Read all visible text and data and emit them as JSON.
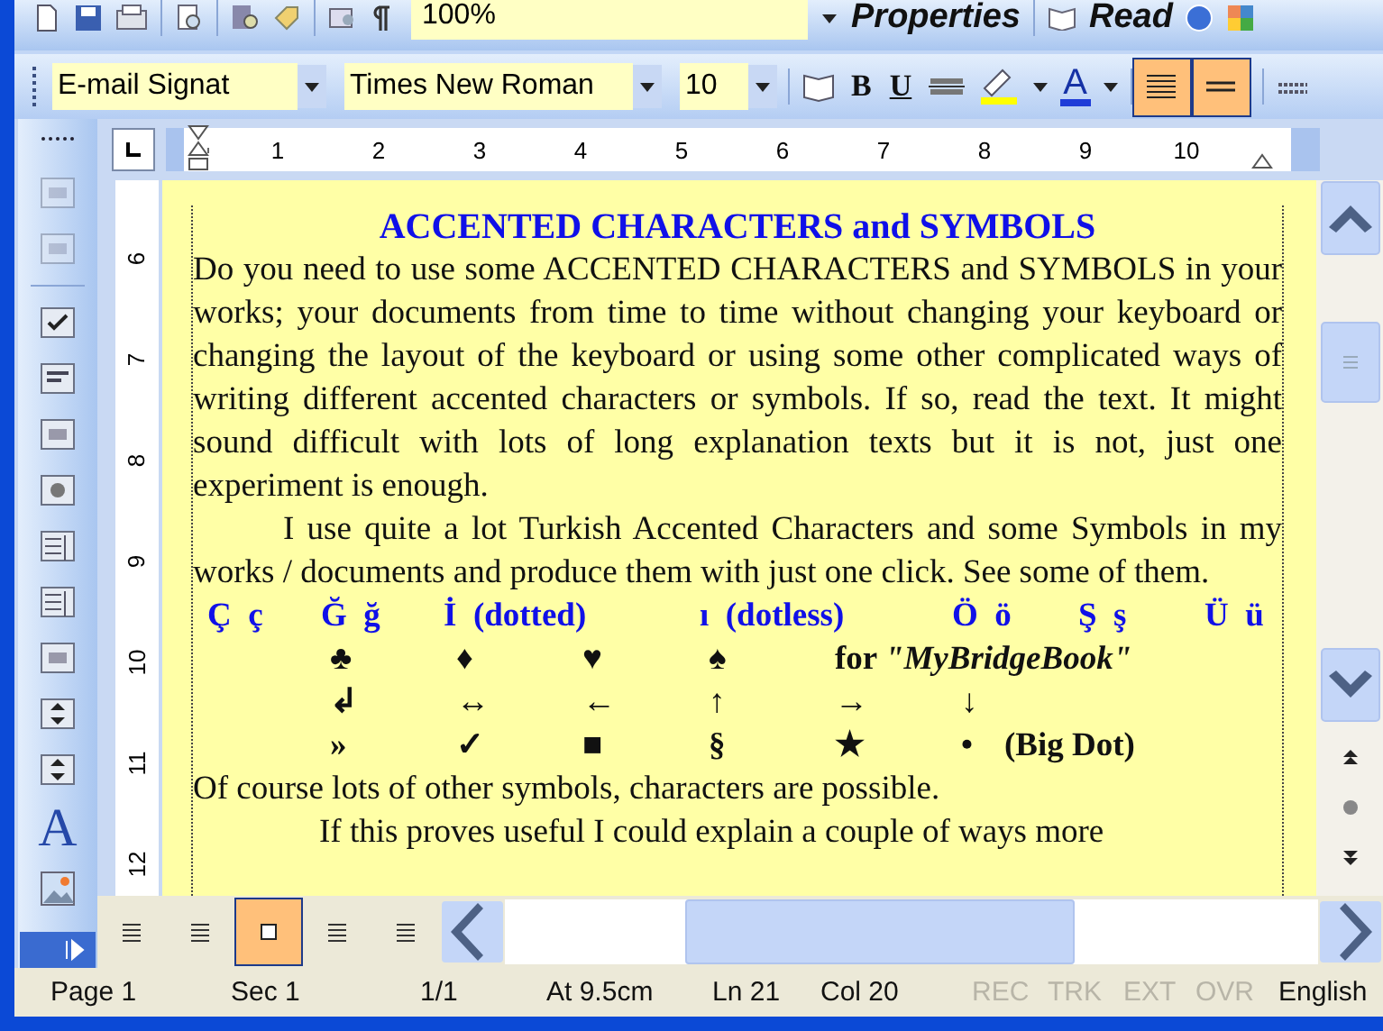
{
  "standard_toolbar": {
    "zoom": "100%",
    "properties": "Properties",
    "read": "Read"
  },
  "formatting_toolbar": {
    "style": "E-mail Signat",
    "font": "Times New Roman",
    "size": "10",
    "bold": "B",
    "underline": "U",
    "font_color": "A",
    "align_buttons": [
      {
        "selected": true
      },
      {
        "selected": true
      }
    ]
  },
  "left_toolbar": {
    "label_tool": "A"
  },
  "horizontal_ruler": [
    "1",
    "2",
    "3",
    "4",
    "5",
    "6",
    "7",
    "8",
    "9",
    "10"
  ],
  "vertical_ruler": [
    "6",
    "7",
    "8",
    "9",
    "10",
    "11",
    "12"
  ],
  "document": {
    "title": "ACCENTED CHARACTERS and SYMBOLS",
    "paragraphs": [
      {
        "text": "Do you need to use some ACCENTED CHARACTERS and SYMBOLS in your works; your documents from time to time without changing your keyboard or changing the layout of the keyboard or using some other complicated ways of writing different accented characters or symbols. If so, read the text. It might sound difficult with lots of long explanation texts but it is not, just one experiment is enough.",
        "indent": false
      },
      {
        "text": "I use quite a lot Turkish Accented Characters and some Symbols in my works / documents and produce them with just one click. See some of them.",
        "indent": true
      }
    ],
    "letters": [
      "Ç  ç",
      "Ğ  ğ",
      "İ  (dotted)",
      "ı  (dotless)",
      "Ö  ö",
      "Ş  ş",
      "Ü  ü"
    ],
    "symbol_rows": [
      [
        {
          "kind": "symbol",
          "text": "♣"
        },
        {
          "kind": "symbol",
          "text": "♦"
        },
        {
          "kind": "symbol",
          "text": "♥"
        },
        {
          "kind": "symbol",
          "text": "♠"
        },
        {
          "kind": "label",
          "text": "for *\"MyBridgeBook\"*"
        }
      ],
      [
        {
          "kind": "symbol",
          "text": "↲"
        },
        {
          "kind": "symbol",
          "text": "↔"
        },
        {
          "kind": "symbol",
          "text": "←"
        },
        {
          "kind": "symbol",
          "text": "↑"
        },
        {
          "kind": "symbol",
          "text": "→"
        },
        {
          "kind": "symbol",
          "text": "↓"
        }
      ],
      [
        {
          "kind": "symbol",
          "text": "»"
        },
        {
          "kind": "symbol",
          "text": "✓"
        },
        {
          "kind": "symbol",
          "text": "■"
        },
        {
          "kind": "symbol",
          "text": "§"
        },
        {
          "kind": "symbol",
          "text": "★"
        },
        {
          "kind": "dot",
          "text": "•"
        },
        {
          "kind": "label",
          "text": "(Big Dot)"
        }
      ]
    ],
    "closing": [
      {
        "text": "Of course lots of other symbols, characters are possible.",
        "indent": false
      },
      {
        "text": "If this proves useful I could explain a couple of ways more",
        "indent": true
      }
    ]
  },
  "view_buttons": [
    {
      "selected": false
    },
    {
      "selected": false
    },
    {
      "selected": true
    },
    {
      "selected": false
    },
    {
      "selected": false
    }
  ],
  "status_bar": [
    {
      "text": "Page 1",
      "disabled": false
    },
    {
      "text": "Sec 1",
      "disabled": false
    },
    {
      "text": "1/1",
      "disabled": false
    },
    {
      "text": "At 9.5cm",
      "disabled": false
    },
    {
      "text": "Ln 21",
      "disabled": false
    },
    {
      "text": "Col 20",
      "disabled": false
    },
    {
      "text": "REC",
      "disabled": true
    },
    {
      "text": "TRK",
      "disabled": true
    },
    {
      "text": "EXT",
      "disabled": true
    },
    {
      "text": "OVR",
      "disabled": true
    },
    {
      "text": "English",
      "disabled": false
    }
  ]
}
